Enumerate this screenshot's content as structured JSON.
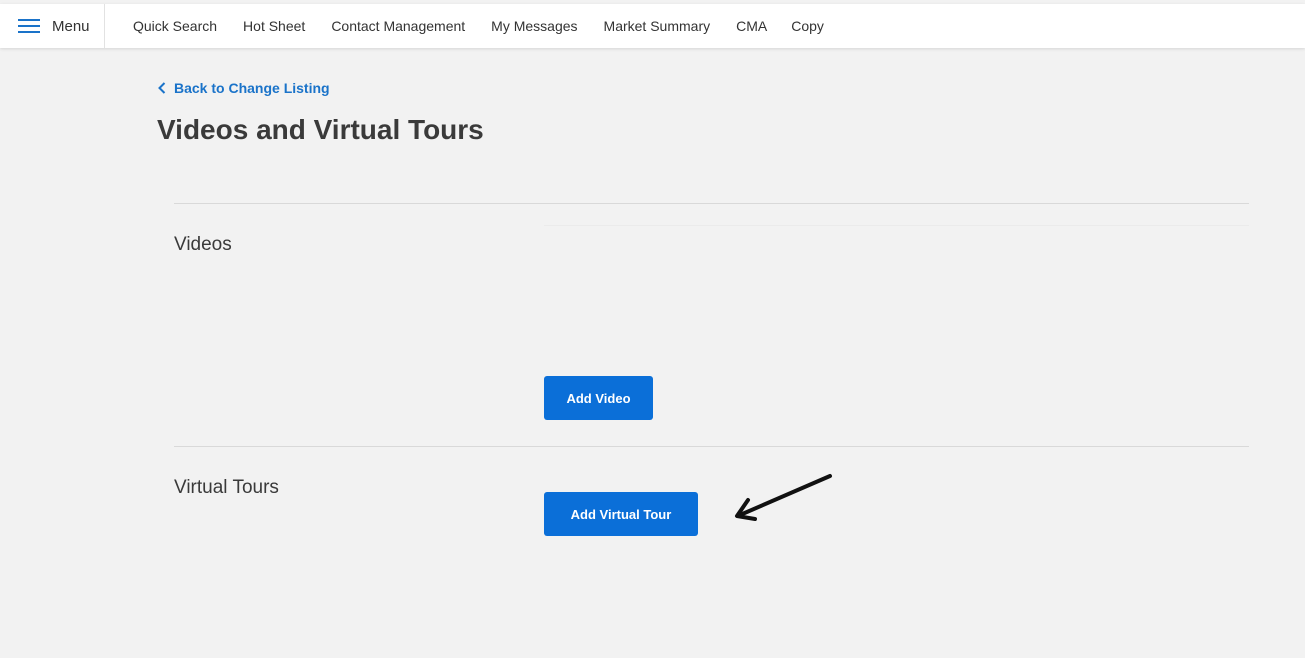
{
  "header": {
    "menu_label": "Menu",
    "nav": [
      "Quick Search",
      "Hot Sheet",
      "Contact Management",
      "My Messages",
      "Market Summary",
      "CMA",
      "Copy"
    ]
  },
  "page": {
    "back_label": "Back to Change Listing",
    "title": "Videos and Virtual Tours"
  },
  "sections": {
    "videos": {
      "label": "Videos",
      "button": "Add Video"
    },
    "tours": {
      "label": "Virtual Tours",
      "button": "Add Virtual Tour"
    }
  },
  "colors": {
    "accent": "#0b6fd8",
    "link": "#1a73c9",
    "background": "#f2f2f2"
  },
  "icons": {
    "menu": "hamburger-icon",
    "back": "chevron-left-icon",
    "annotation": "arrow-annotation"
  }
}
